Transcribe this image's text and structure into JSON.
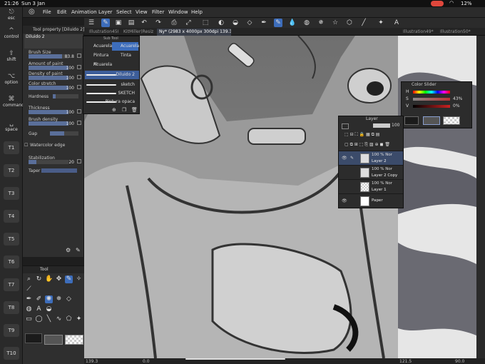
{
  "status": {
    "time": "21:26",
    "date": "Sun 3 Jan",
    "battery": "12%"
  },
  "keybar": {
    "esc": "esc",
    "control": "control",
    "shift": "shift",
    "option": "option",
    "command": "command",
    "space": "space",
    "tkeys": [
      "T1",
      "T2",
      "T3",
      "T4",
      "T5",
      "T6",
      "T7",
      "T8",
      "T9",
      "T10"
    ]
  },
  "menu": [
    "File",
    "Edit",
    "Animation",
    "Layer",
    "Select",
    "View",
    "Filter",
    "Window",
    "Help"
  ],
  "tabs": [
    {
      "label": "Illustration45(Ill",
      "active": false
    },
    {
      "label": "KitMiller(Resiz",
      "active": false
    },
    {
      "label": "Ny* (2983 x 4000px 300dpi 139.3%)",
      "active": true
    },
    {
      "label": "Illustration49*",
      "active": false
    },
    {
      "label": "Illustration50*",
      "active": false
    }
  ],
  "tool_property": {
    "title": "Tool property [Diluido 2]",
    "brush": "Diluido 2",
    "props": [
      {
        "label": "Brush Size",
        "value": "83.8",
        "fraction": 0.84
      },
      {
        "label": "Amount of paint",
        "value": "100",
        "fraction": 1.0
      },
      {
        "label": "Density of paint",
        "value": "100",
        "fraction": 1.0
      },
      {
        "label": "Color stretch",
        "value": "100",
        "fraction": 1.0
      },
      {
        "label": "Hardness",
        "value": "",
        "fraction": 0.1
      },
      {
        "label": "Thickness",
        "value": "100",
        "fraction": 1.0
      },
      {
        "label": "Brush density",
        "value": "100",
        "fraction": 1.0
      },
      {
        "label": "Gap",
        "value": "",
        "fraction": 0.5
      },
      {
        "label": "Watercolor edge",
        "value": "",
        "fraction": 0
      },
      {
        "label": "Stabilization",
        "value": "20",
        "fraction": 0.2
      },
      {
        "label": "Taper",
        "value": "",
        "fraction": 0
      }
    ]
  },
  "subtool": {
    "title": "Sub Tool",
    "groups": [
      {
        "label": "Acuarela",
        "selected": false
      },
      {
        "label": "Acuarela",
        "selected": true
      },
      {
        "label": "Pintura m",
        "selected": false
      },
      {
        "label": "Tinta",
        "selected": false
      },
      {
        "label": "Acuarela",
        "selected": false
      }
    ],
    "brushes": [
      {
        "label": "Diluido 2",
        "selected": true
      },
      {
        "label": "sketch",
        "selected": false
      },
      {
        "label": "SKETCH",
        "selected": false
      },
      {
        "label": "Pintura opaca",
        "selected": false
      }
    ]
  },
  "tool_palette": {
    "title": "Tool"
  },
  "color_slider": {
    "title": "Color Slider",
    "rows": [
      {
        "key": "H",
        "value": "",
        "gradient": "linear-gradient(to right,#f00,#ff0,#0f0,#0ff,#00f,#f0f,#f00)"
      },
      {
        "key": "S",
        "value": "43%",
        "gradient": "linear-gradient(to right,#888,#b33)"
      },
      {
        "key": "V",
        "value": "0%",
        "gradient": "linear-gradient(to right,#000,#c22)"
      }
    ]
  },
  "layer": {
    "title": "Layer",
    "opacity": "100",
    "layers": [
      {
        "opacity": "100 % Nor",
        "name": "Layer 2",
        "selected": true,
        "visible": true
      },
      {
        "opacity": "100 % Nor",
        "name": "Layer 2 Copy",
        "selected": false,
        "visible": false
      },
      {
        "opacity": "100 % Nor",
        "name": "Layer 1",
        "selected": false,
        "visible": false
      },
      {
        "opacity": "",
        "name": "Paper",
        "selected": false,
        "visible": true
      }
    ]
  },
  "canvas_status": {
    "zoom": "139.3",
    "angle": "0.0",
    "right_zoom": "121.5",
    "right_angle": "90.0"
  },
  "colors": {
    "accent": "#3d6dbb",
    "panel": "#2f2f2f",
    "menubar": "#2b2b2b"
  }
}
